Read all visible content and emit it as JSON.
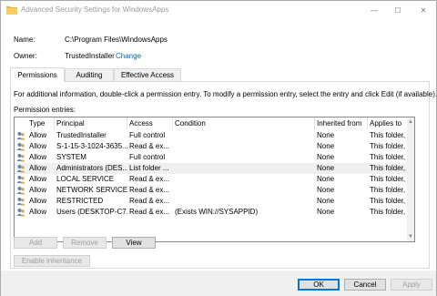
{
  "window": {
    "title": "Advanced Security Settings for WindowsApps",
    "minimize_glyph": "—",
    "maximize_glyph": "☐",
    "close_glyph": "✕"
  },
  "info": {
    "name_label": "Name:",
    "name_value": "C:\\Program Files\\WindowsApps",
    "owner_label": "Owner:",
    "owner_value": "TrustedInstaller",
    "change_link": "Change"
  },
  "tabs": [
    {
      "label": "Permissions",
      "active": true
    },
    {
      "label": "Auditing",
      "active": false
    },
    {
      "label": "Effective Access",
      "active": false
    }
  ],
  "permissions": {
    "description": "For additional information, double-click a permission entry. To modify a permission entry, select the entry and click Edit (if available).",
    "entries_label": "Permission entries:",
    "columns": [
      "Type",
      "Principal",
      "Access",
      "Condition",
      "Inherited from",
      "Applies to"
    ],
    "rows": [
      {
        "type": "Allow",
        "principal": "TrustedInstaller",
        "access": "Full control",
        "condition": "",
        "inherited": "None",
        "applies": "This folder, ..."
      },
      {
        "type": "Allow",
        "principal": "S-1-15-3-1024-3635...",
        "access": "Read & ex...",
        "condition": "",
        "inherited": "None",
        "applies": "This folder, ..."
      },
      {
        "type": "Allow",
        "principal": "SYSTEM",
        "access": "Full control",
        "condition": "",
        "inherited": "None",
        "applies": "This folder, ..."
      },
      {
        "type": "Allow",
        "principal": "Administrators (DES...",
        "access": "List folder ...",
        "condition": "",
        "inherited": "None",
        "applies": "This folder, ..."
      },
      {
        "type": "Allow",
        "principal": "LOCAL SERVICE",
        "access": "Read & ex...",
        "condition": "",
        "inherited": "None",
        "applies": "This folder, ..."
      },
      {
        "type": "Allow",
        "principal": "NETWORK SERVICE",
        "access": "Read & ex...",
        "condition": "",
        "inherited": "None",
        "applies": "This folder, ..."
      },
      {
        "type": "Allow",
        "principal": "RESTRICTED",
        "access": "Read & ex...",
        "condition": "",
        "inherited": "None",
        "applies": "This folder, ..."
      },
      {
        "type": "Allow",
        "principal": "Users (DESKTOP-C7...",
        "access": "Read & ex...",
        "condition": "(Exists WIN://SYSAPPID)",
        "inherited": "None",
        "applies": "This folder, ..."
      }
    ],
    "selected_row": 3
  },
  "buttons": {
    "add": "Add",
    "remove": "Remove",
    "view": "View",
    "enable_inheritance": "Enable inheritance",
    "ok": "OK",
    "cancel": "Cancel",
    "apply": "Apply"
  },
  "colors": {
    "link": "#0066cc",
    "folder_icon": "#e8b83f",
    "selection": "#f0f0f0"
  },
  "icons": {
    "title": "folder-icon",
    "row": "users-group-icon"
  }
}
